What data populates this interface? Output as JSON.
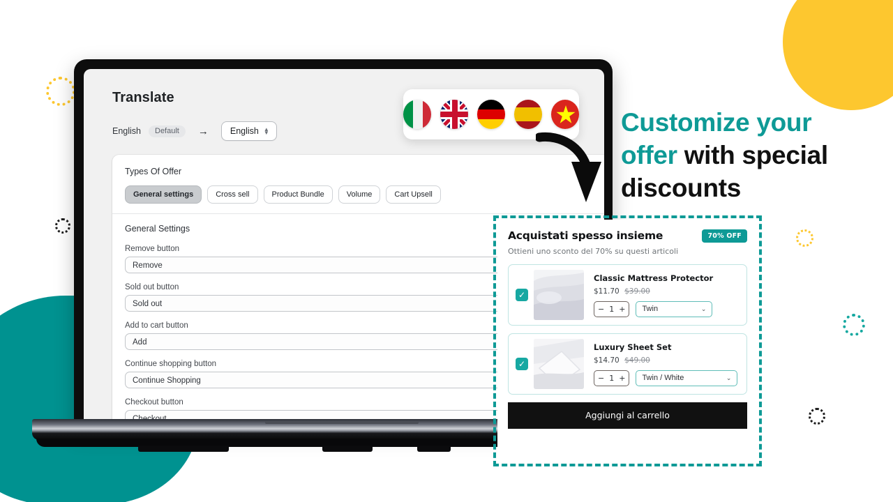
{
  "admin": {
    "page_title": "Translate",
    "language_from": "English",
    "default_badge": "Default",
    "arrow": "→",
    "language_to": "English",
    "types_of_offer_label": "Types Of Offer",
    "tabs": [
      {
        "label": "General settings",
        "active": true
      },
      {
        "label": "Cross sell",
        "active": false
      },
      {
        "label": "Product Bundle",
        "active": false
      },
      {
        "label": "Volume",
        "active": false
      },
      {
        "label": "Cart Upsell",
        "active": false
      }
    ],
    "section_title": "General Settings",
    "fields": [
      {
        "label": "Remove button",
        "value": "Remove"
      },
      {
        "label": "Sold out button",
        "value": "Sold out"
      },
      {
        "label": "Add to cart button",
        "value": "Add"
      },
      {
        "label": "Continue shopping button",
        "value": "Continue Shopping"
      },
      {
        "label": "Checkout button",
        "value": "Checkout"
      }
    ]
  },
  "flags": [
    {
      "name": "flag-italy",
      "label": "Italy"
    },
    {
      "name": "flag-united-kingdom",
      "label": "United Kingdom"
    },
    {
      "name": "flag-germany",
      "label": "Germany"
    },
    {
      "name": "flag-spain",
      "label": "Spain"
    },
    {
      "name": "flag-vietnam",
      "label": "Vietnam"
    }
  ],
  "headline": {
    "line1_accent": "Customize your",
    "line2_accent": "offer ",
    "line2_rest": "with special",
    "line3": "discounts"
  },
  "bundle": {
    "title": "Acquistati spesso insieme",
    "badge": "70% OFF",
    "subtitle": "Ottieni uno sconto del 70% su questi articoli",
    "products": [
      {
        "name": "Classic Mattress Protector",
        "price": "$11.70",
        "compare_at_price": "$39.00",
        "quantity": "1",
        "minus": "−",
        "plus": "+",
        "variant": "Twin",
        "checked": true
      },
      {
        "name": "Luxury Sheet Set",
        "price": "$14.70",
        "compare_at_price": "$49.00",
        "quantity": "1",
        "minus": "−",
        "plus": "+",
        "variant": "Twin / White",
        "checked": true
      }
    ],
    "cta_label": "Aggiungi al carrello"
  },
  "colors": {
    "teal": "#0E9A96",
    "yellow": "#FDC72F",
    "teal_blob": "#009290",
    "cta_black": "#111111"
  }
}
